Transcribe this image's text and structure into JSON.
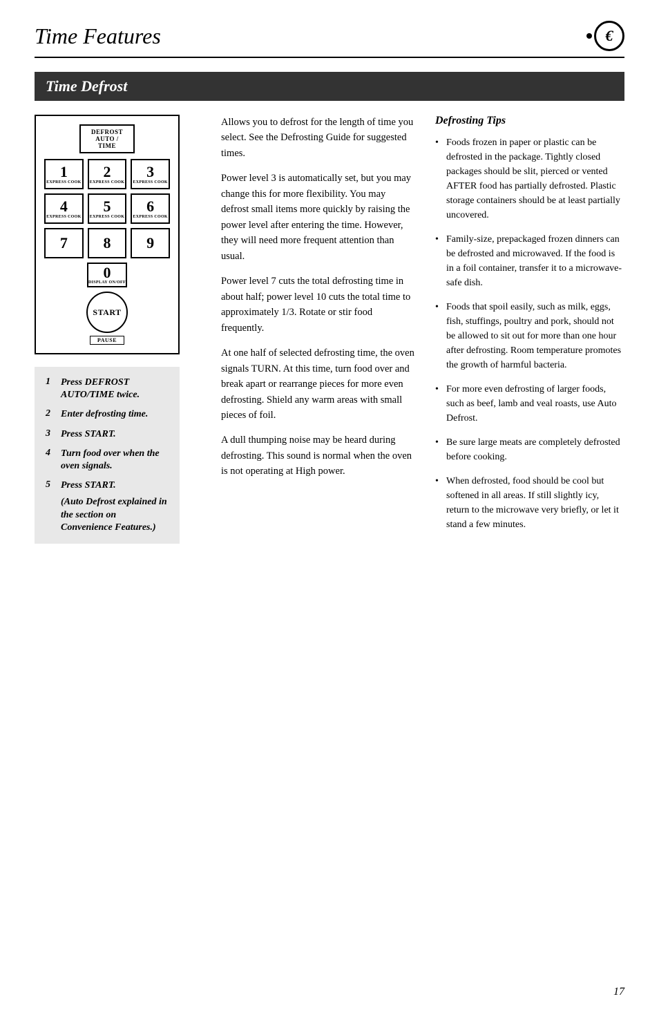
{
  "header": {
    "title": "Time Features",
    "icon_char": "€"
  },
  "section": {
    "title": "Time Defrost"
  },
  "keypad": {
    "top_button": "DEFROST\nAUTO / TIME",
    "keys": [
      {
        "number": "1",
        "label": "EXPRESS COOK"
      },
      {
        "number": "2",
        "label": "EXPRESS COOK"
      },
      {
        "number": "3",
        "label": "EXPRESS COOK"
      },
      {
        "number": "4",
        "label": "EXPRESS COOK"
      },
      {
        "number": "5",
        "label": "EXPRESS COOK"
      },
      {
        "number": "6",
        "label": "EXPRESS COOK"
      },
      {
        "number": "7",
        "label": ""
      },
      {
        "number": "8",
        "label": ""
      },
      {
        "number": "9",
        "label": ""
      },
      {
        "number": "0",
        "label": "DISPLAY ON/OFF"
      }
    ],
    "start_label": "START",
    "pause_label": "PAUSE"
  },
  "steps": [
    {
      "num": "1",
      "text": "Press DEFROST AUTO/TIME twice."
    },
    {
      "num": "2",
      "text": "Enter defrosting time."
    },
    {
      "num": "3",
      "text": "Press START."
    },
    {
      "num": "4",
      "text": "Turn food over when the oven signals."
    },
    {
      "num": "5",
      "text": "Press START."
    },
    {
      "note": "(Auto Defrost explained in the section on Convenience Features.)"
    }
  ],
  "middle_paragraphs": [
    "Allows you to defrost for the length of time you select. See the Defrosting Guide for suggested times.",
    "Power level 3 is automatically set, but you may change this for more flexibility. You may defrost small items more quickly by raising the power level after entering the time. However, they will need more frequent attention than usual.",
    "Power level 7 cuts the total defrosting time in about half; power level 10 cuts the total time to approximately 1/3. Rotate or stir food frequently.",
    "At one half of selected defrosting time, the oven signals TURN. At this time, turn food over and break apart or rearrange pieces for more even defrosting. Shield any warm areas with small pieces of foil.",
    "A dull thumping noise may be heard during defrosting. This sound is normal when the oven is not operating at High power."
  ],
  "tips": {
    "title": "Defrosting Tips",
    "items": [
      "Foods frozen in paper or plastic can be defrosted in the package. Tightly closed packages should be slit, pierced or vented AFTER food has partially defrosted. Plastic storage containers should be at least partially uncovered.",
      "Family-size, prepackaged frozen dinners can be defrosted and microwaved. If the food is in a foil container, transfer it to a microwave-safe dish.",
      "Foods that spoil easily, such as milk, eggs, fish, stuffings, poultry and pork, should not be allowed to sit out for more than one hour after defrosting. Room temperature promotes the growth of harmful bacteria.",
      "For more even defrosting of larger foods, such as beef, lamb and veal roasts, use Auto Defrost.",
      "Be sure large meats are completely defrosted before cooking.",
      "When defrosted, food should be cool but softened in all areas. If still slightly icy, return to the microwave very briefly, or let it stand a few minutes."
    ]
  },
  "page_number": "17"
}
